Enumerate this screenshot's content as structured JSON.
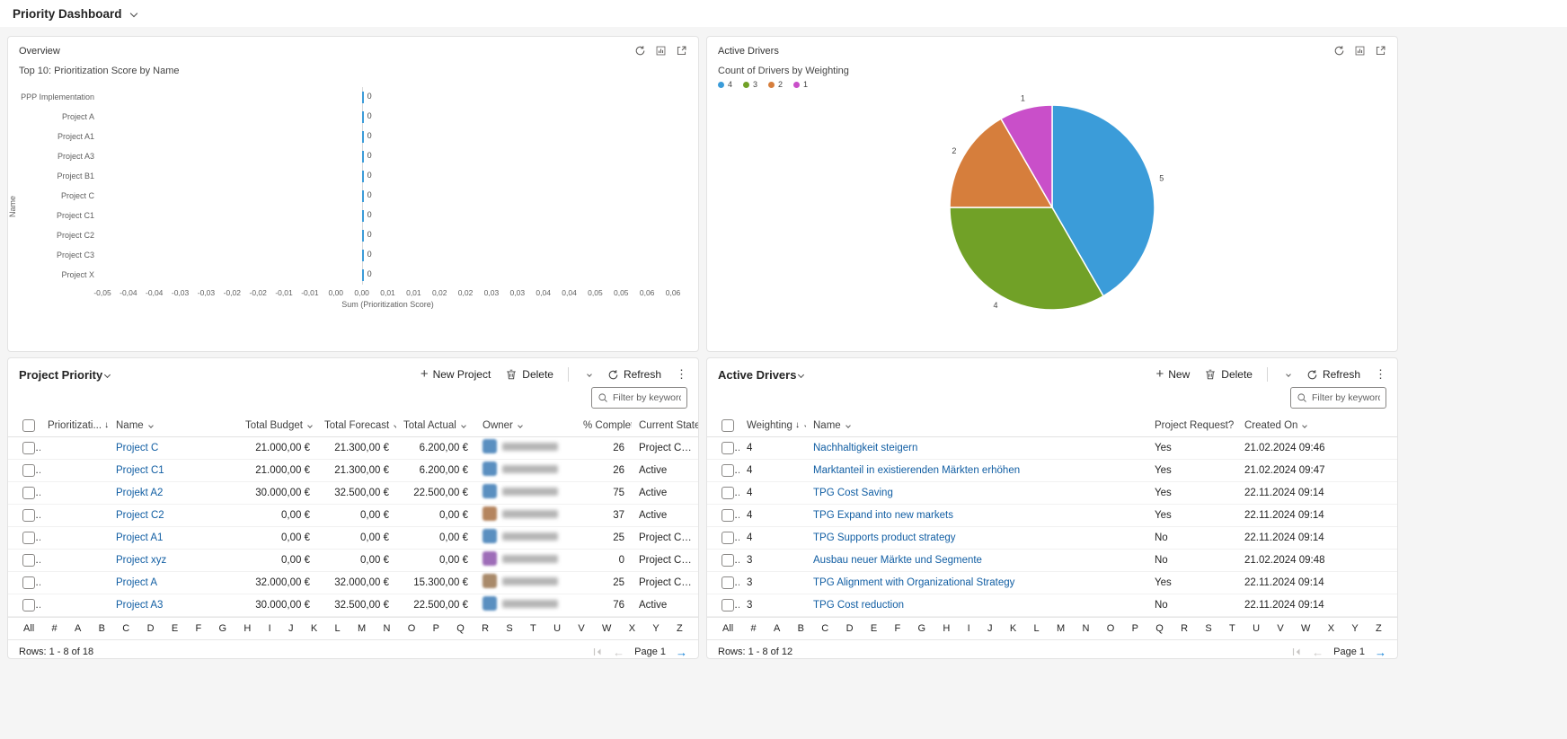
{
  "page": {
    "title": "Priority Dashboard"
  },
  "panels": {
    "overview": {
      "title": "Overview"
    },
    "active_drivers_chart": {
      "title": "Active Drivers"
    }
  },
  "chart_data": [
    {
      "type": "bar",
      "orientation": "horizontal",
      "title": "Top 10: Prioritization Score by Name",
      "categories": [
        "PPP Implementation",
        "Project A",
        "Project A1",
        "Project A3",
        "Project B1",
        "Project C",
        "Project C1",
        "Project C2",
        "Project C3",
        "Project X"
      ],
      "values": [
        0,
        0,
        0,
        0,
        0,
        0,
        0,
        0,
        0,
        0
      ],
      "value_labels": [
        "0",
        "0",
        "0",
        "0",
        "0",
        "0",
        "0",
        "0",
        "0",
        "0"
      ],
      "bar_color": "#3b9cd9",
      "xlabel": "Sum (Prioritization Score)",
      "ylabel": "Name",
      "xlim": [
        -0.05,
        0.06
      ],
      "x_tick_labels": [
        "-0,05",
        "-0,04",
        "-0,04",
        "-0,03",
        "-0,03",
        "-0,02",
        "-0,02",
        "-0,01",
        "-0,01",
        "0,00",
        "0,00",
        "0,01",
        "0,01",
        "0,02",
        "0,02",
        "0,03",
        "0,03",
        "0,04",
        "0,04",
        "0,05",
        "0,05",
        "0,06",
        "0,06"
      ],
      "grid": false
    },
    {
      "type": "pie",
      "title": "Count of Drivers by Weighting",
      "labels": [
        "4",
        "3",
        "2",
        "1"
      ],
      "values": [
        5,
        4,
        2,
        1
      ],
      "slice_labels": [
        "5",
        "4",
        "2",
        "1"
      ],
      "colors": [
        "#3b9cd9",
        "#71a127",
        "#d67e3c",
        "#c94fc9"
      ],
      "legend_position": "top-left"
    }
  ],
  "project_grid": {
    "title": "Project Priority",
    "commands": {
      "new": "New Project",
      "delete": "Delete",
      "refresh": "Refresh"
    },
    "filter_placeholder": "Filter by keyword",
    "columns": [
      "Prioritizati...",
      "Name",
      "Total Budget",
      "Total Forecast",
      "Total Actual",
      "Owner",
      "% Complete",
      "Current State"
    ],
    "sorted_column_index": 0,
    "rows": [
      {
        "prioritization": "",
        "name": "Project C",
        "total_budget": "21.000,00 €",
        "total_forecast": "21.300,00 €",
        "total_actual": "6.200,00 €",
        "owner_avatar_color": "#5a8fc0",
        "percent_complete": "26",
        "current_state": "Project Crea..."
      },
      {
        "prioritization": "",
        "name": "Project C1",
        "total_budget": "21.000,00 €",
        "total_forecast": "21.300,00 €",
        "total_actual": "6.200,00 €",
        "owner_avatar_color": "#5a8fc0",
        "percent_complete": "26",
        "current_state": "Active"
      },
      {
        "prioritization": "",
        "name": "Projekt A2",
        "total_budget": "30.000,00 €",
        "total_forecast": "32.500,00 €",
        "total_actual": "22.500,00 €",
        "owner_avatar_color": "#5a8fc0",
        "percent_complete": "75",
        "current_state": "Active"
      },
      {
        "prioritization": "",
        "name": "Project C2",
        "total_budget": "0,00 €",
        "total_forecast": "0,00 €",
        "total_actual": "0,00 €",
        "owner_avatar_color": "#b5855f",
        "percent_complete": "37",
        "current_state": "Active"
      },
      {
        "prioritization": "",
        "name": "Project A1",
        "total_budget": "0,00 €",
        "total_forecast": "0,00 €",
        "total_actual": "0,00 €",
        "owner_avatar_color": "#5a8fc0",
        "percent_complete": "25",
        "current_state": "Project Crea..."
      },
      {
        "prioritization": "",
        "name": "Project xyz",
        "total_budget": "0,00 €",
        "total_forecast": "0,00 €",
        "total_actual": "0,00 €",
        "owner_avatar_color": "#9e6db8",
        "percent_complete": "0",
        "current_state": "Project Crea..."
      },
      {
        "prioritization": "",
        "name": "Project A",
        "total_budget": "32.000,00 €",
        "total_forecast": "32.000,00 €",
        "total_actual": "15.300,00 €",
        "owner_avatar_color": "#a98a6a",
        "percent_complete": "25",
        "current_state": "Project Crea..."
      },
      {
        "prioritization": "",
        "name": "Project A3",
        "total_budget": "30.000,00 €",
        "total_forecast": "32.500,00 €",
        "total_actual": "22.500,00 €",
        "owner_avatar_color": "#5a8fc0",
        "percent_complete": "76",
        "current_state": "Active"
      }
    ],
    "rows_status": "Rows: 1 - 8 of 18",
    "page_label": "Page 1"
  },
  "drivers_grid": {
    "title": "Active Drivers",
    "commands": {
      "new": "New",
      "delete": "Delete",
      "refresh": "Refresh"
    },
    "filter_placeholder": "Filter by keyword",
    "columns": [
      "Weighting",
      "Name",
      "Project Request?",
      "Created On"
    ],
    "sorted_column_index": 0,
    "rows": [
      {
        "weighting": "4",
        "name": "Nachhaltigkeit steigern",
        "project_request": "Yes",
        "created_on": "21.02.2024 09:46"
      },
      {
        "weighting": "4",
        "name": "Marktanteil in existierenden Märkten erhöhen",
        "project_request": "Yes",
        "created_on": "21.02.2024 09:47"
      },
      {
        "weighting": "4",
        "name": "TPG Cost Saving",
        "project_request": "Yes",
        "created_on": "22.11.2024 09:14"
      },
      {
        "weighting": "4",
        "name": "TPG Expand into new markets",
        "project_request": "Yes",
        "created_on": "22.11.2024 09:14"
      },
      {
        "weighting": "4",
        "name": "TPG Supports product strategy",
        "project_request": "No",
        "created_on": "22.11.2024 09:14"
      },
      {
        "weighting": "3",
        "name": "Ausbau neuer Märkte und Segmente",
        "project_request": "No",
        "created_on": "21.02.2024 09:48"
      },
      {
        "weighting": "3",
        "name": "TPG Alignment with Organizational Strategy",
        "project_request": "Yes",
        "created_on": "22.11.2024 09:14"
      },
      {
        "weighting": "3",
        "name": "TPG Cost reduction",
        "project_request": "No",
        "created_on": "22.11.2024 09:14"
      }
    ],
    "rows_status": "Rows: 1 - 8 of 12",
    "page_label": "Page 1"
  },
  "jump_bar": [
    "All",
    "#",
    "A",
    "B",
    "C",
    "D",
    "E",
    "F",
    "G",
    "H",
    "I",
    "J",
    "K",
    "L",
    "M",
    "N",
    "O",
    "P",
    "Q",
    "R",
    "S",
    "T",
    "U",
    "V",
    "W",
    "X",
    "Y",
    "Z"
  ]
}
